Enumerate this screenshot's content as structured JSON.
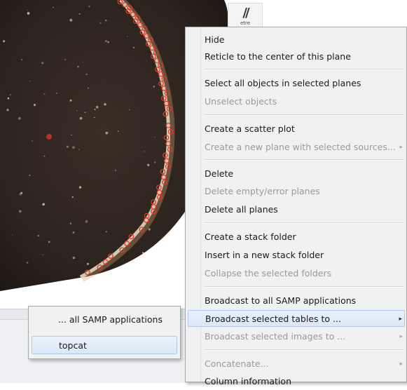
{
  "plane_icon": {
    "caption": "etre"
  },
  "context_menu": {
    "items": [
      {
        "label": "Hide",
        "disabled": false
      },
      {
        "label": "Reticle to the center of this plane",
        "disabled": false
      },
      {
        "label": "Select all objects in selected planes",
        "disabled": false
      },
      {
        "label": "Unselect objects",
        "disabled": true
      },
      {
        "label": "Create a scatter plot",
        "disabled": false
      },
      {
        "label": "Create a new plane with selected sources...",
        "disabled": true,
        "submenu_arrow": "▸"
      },
      {
        "label": "Delete",
        "disabled": false
      },
      {
        "label": "Delete empty/error planes",
        "disabled": true
      },
      {
        "label": "Delete all planes",
        "disabled": false
      },
      {
        "label": "Create a stack folder",
        "disabled": false
      },
      {
        "label": "Insert in a new stack folder",
        "disabled": false
      },
      {
        "label": "Collapse the selected folders",
        "disabled": true
      },
      {
        "label": "Broadcast to all SAMP applications",
        "disabled": false
      },
      {
        "label": "Broadcast selected tables to ...",
        "disabled": false,
        "highlighted": true,
        "submenu_arrow": "▸"
      },
      {
        "label": "Broadcast selected images to ...",
        "disabled": true,
        "submenu_arrow": "▸"
      },
      {
        "label": "Concatenate...",
        "disabled": true,
        "submenu_arrow": "▸"
      },
      {
        "label": "Column information",
        "disabled": false
      }
    ]
  },
  "submenu": {
    "items": [
      {
        "label": "... all SAMP applications"
      },
      {
        "label": "topcat"
      }
    ]
  },
  "colors": {
    "menu_background": "#f1f1f1",
    "highlight_border": "#aecbef",
    "disabled_text": "#9a9a9a",
    "sky_background": "#2a221c",
    "source_marker": "#e23a2a"
  }
}
